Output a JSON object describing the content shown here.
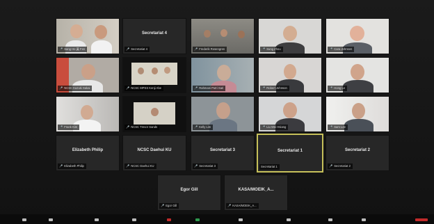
{
  "tiles": [
    {
      "id": "t1",
      "label": "Sang Ho 黃 Fen",
      "center": ""
    },
    {
      "id": "t2",
      "label": "Secretariat 4",
      "center": "Secretariat 4"
    },
    {
      "id": "t3",
      "label": "Frederik Rosengren",
      "center": ""
    },
    {
      "id": "t4",
      "label": "Sung Zhou",
      "center": ""
    },
    {
      "id": "t5",
      "label": "Cara Johnsen",
      "center": ""
    },
    {
      "id": "t6",
      "label": "NCSC Kazuki Sakai",
      "center": ""
    },
    {
      "id": "t7",
      "label": "NCSC MPSS Kenji Abe",
      "center": ""
    },
    {
      "id": "t8",
      "label": "Rahmani Putri Sari",
      "center": ""
    },
    {
      "id": "t9",
      "label": "Robert Johnson",
      "center": ""
    },
    {
      "id": "t10",
      "label": "Hong Le",
      "center": ""
    },
    {
      "id": "t11",
      "label": "Frank Kim",
      "center": ""
    },
    {
      "id": "t12",
      "label": "NCSC Trevor Sands",
      "center": ""
    },
    {
      "id": "t13",
      "label": "Kelly Lim",
      "center": ""
    },
    {
      "id": "t14",
      "label": "Liu Wei Hsiang",
      "center": ""
    },
    {
      "id": "t15",
      "label": "Sam Lee",
      "center": ""
    },
    {
      "id": "t16",
      "label": "Elizabeth Philip",
      "center": "Elizabeth Philip"
    },
    {
      "id": "t17",
      "label": "NCSC Daehui KU",
      "center": "NCSC Daehui KU"
    },
    {
      "id": "t18",
      "label": "Secretariat 3",
      "center": "Secretariat 3"
    },
    {
      "id": "t19",
      "label": "Secretariat 1",
      "center": "Secretariat 1"
    },
    {
      "id": "t20",
      "label": "Secretariat 2",
      "center": "Secretariat 2"
    },
    {
      "id": "t21",
      "label": "Egor Gill",
      "center": "Egor Gill"
    },
    {
      "id": "t22",
      "label": "KASA/MOEIK_A...",
      "center": "KASA/MOEIK_A..."
    }
  ],
  "colors": {
    "accent_border": "#c7c15a",
    "mic_muted": "#e23d3d"
  },
  "icons": [
    "mute-icon",
    "video-icon",
    "security-icon",
    "participants-icon",
    "chat-icon",
    "share-screen-icon",
    "record-icon",
    "reactions-icon",
    "end-call-icon"
  ]
}
